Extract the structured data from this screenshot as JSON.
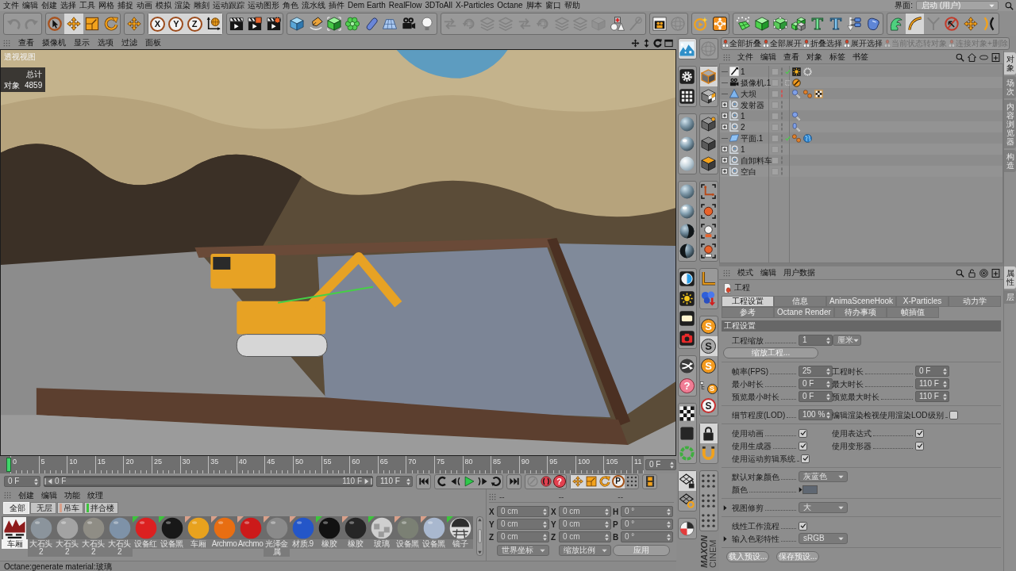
{
  "menu_bar": {
    "items": [
      "文件",
      "编辑",
      "创建",
      "选择",
      "工具",
      "网格",
      "捕捉",
      "动画",
      "模拟",
      "渲染",
      "雕刻",
      "运动跟踪",
      "运动图形",
      "角色",
      "流水线",
      "插件",
      "Dem Earth",
      "RealFlow",
      "3DToAll",
      "X-Particles",
      "Octane",
      "脚本",
      "窗口",
      "帮助"
    ],
    "layout_label": "界面:",
    "layout_value": "启动 (用户)"
  },
  "toolbar": {
    "groups": [
      {
        "tools": [
          {
            "kind": "undo",
            "selected": false,
            "disabled": true
          },
          {
            "kind": "redo",
            "selected": false,
            "disabled": true
          }
        ]
      },
      {
        "tools": [
          {
            "kind": "select",
            "selected": false,
            "disabled": false
          },
          {
            "kind": "move",
            "selected": true,
            "disabled": false
          },
          {
            "kind": "scale",
            "selected": false,
            "disabled": false
          },
          {
            "kind": "rotate",
            "selected": false,
            "disabled": false
          }
        ]
      },
      {
        "tools": [
          {
            "kind": "move",
            "selected": false,
            "disabled": false
          }
        ]
      },
      {
        "tools": [
          {
            "kind": "axis",
            "label": "X",
            "selected": true,
            "disabled": false
          },
          {
            "kind": "axis",
            "label": "Y",
            "selected": true,
            "disabled": false
          },
          {
            "kind": "axis",
            "label": "Z",
            "selected": true,
            "disabled": false
          },
          {
            "kind": "world",
            "selected": true,
            "disabled": false
          }
        ]
      },
      {
        "tools": [
          {
            "kind": "clapper",
            "selected": false,
            "disabled": false
          },
          {
            "kind": "clapper-tile",
            "selected": false,
            "disabled": false
          },
          {
            "kind": "clapper-gear",
            "selected": false,
            "disabled": false
          }
        ]
      },
      {
        "tools": [
          {
            "kind": "cube-blue",
            "selected": false,
            "disabled": false
          },
          {
            "kind": "pen",
            "selected": false,
            "disabled": false
          },
          {
            "kind": "cube-frame",
            "selected": false,
            "disabled": false
          },
          {
            "kind": "flower",
            "selected": false,
            "disabled": false
          },
          {
            "kind": "capsule",
            "selected": false,
            "disabled": false
          },
          {
            "kind": "floor",
            "selected": false,
            "disabled": false
          },
          {
            "kind": "camera",
            "selected": false,
            "disabled": false
          },
          {
            "kind": "bulb",
            "selected": false,
            "disabled": false
          }
        ]
      },
      {
        "tools": [
          {
            "kind": "faded-arrows",
            "selected": false,
            "disabled": true
          },
          {
            "kind": "faded-loop",
            "selected": false,
            "disabled": true
          },
          {
            "kind": "faded-stack",
            "selected": false,
            "disabled": true
          },
          {
            "kind": "faded-stack",
            "selected": false,
            "disabled": true
          },
          {
            "kind": "faded-arrows",
            "selected": false,
            "disabled": true
          },
          {
            "kind": "faded-loop",
            "selected": false,
            "disabled": true
          },
          {
            "kind": "faded-stack",
            "selected": false,
            "disabled": true
          },
          {
            "kind": "faded-stack",
            "selected": false,
            "disabled": true
          },
          {
            "kind": "faded-cube",
            "selected": false,
            "disabled": true
          },
          {
            "kind": "shapes",
            "selected": false,
            "disabled": false
          },
          {
            "kind": "faded-slash",
            "selected": false,
            "disabled": true
          }
        ]
      },
      {
        "tools": [
          {
            "kind": "clapper-camera",
            "selected": false,
            "disabled": false
          },
          {
            "kind": "faded-sphere",
            "selected": false,
            "disabled": true
          }
        ]
      },
      {
        "tools": [
          {
            "kind": "play-circle",
            "selected": false,
            "disabled": false
          },
          {
            "kind": "node-cluster",
            "selected": false,
            "disabled": false
          }
        ]
      },
      {
        "tools": [
          {
            "kind": "sparkle-grid",
            "selected": false,
            "disabled": false
          },
          {
            "kind": "cube-green",
            "selected": false,
            "disabled": false
          },
          {
            "kind": "node-cube",
            "selected": false,
            "disabled": false
          },
          {
            "kind": "stacked-cubes",
            "selected": false,
            "disabled": false
          },
          {
            "kind": "text-green",
            "label": "T",
            "selected": false,
            "disabled": false
          },
          {
            "kind": "text-blue",
            "label": "T",
            "selected": false,
            "disabled": false
          },
          {
            "kind": "branch",
            "selected": false,
            "disabled": false
          },
          {
            "kind": "blob",
            "selected": false,
            "disabled": false
          }
        ]
      },
      {
        "tools": [
          {
            "kind": "leaf",
            "selected": false,
            "disabled": false
          },
          {
            "kind": "curve",
            "selected": true,
            "disabled": false
          },
          {
            "kind": "faded-fork",
            "selected": false,
            "disabled": true
          },
          {
            "kind": "no-arrow",
            "selected": false,
            "disabled": false
          },
          {
            "kind": "move",
            "selected": false,
            "disabled": false
          },
          {
            "kind": "bracket",
            "selected": false,
            "disabled": false
          }
        ]
      }
    ]
  },
  "viewport": {
    "menu": [
      "查看",
      "摄像机",
      "显示",
      "选项",
      "过滤",
      "面板"
    ],
    "title": "透视视图",
    "stats": {
      "heading": "总计",
      "label": "对象",
      "value": "4859"
    }
  },
  "timeline": {
    "ticks": [
      "0",
      "5",
      "10",
      "15",
      "20",
      "25",
      "30",
      "35",
      "40",
      "45",
      "50",
      "55",
      "60",
      "65",
      "70",
      "75",
      "80",
      "85",
      "90",
      "95",
      "100",
      "105",
      "11"
    ],
    "playhead": {
      "level": 0
    },
    "current": "0 F"
  },
  "transport": {
    "start": "0 F",
    "range": {
      "start": "0 F",
      "end": "110 F",
      "level": 1
    },
    "end": "110 F",
    "groups": [
      {
        "tools": [
          {
            "kind": "skip-start",
            "selected": false,
            "disabled": false
          }
        ]
      },
      {
        "tools": [
          {
            "kind": "loop-back",
            "selected": false,
            "disabled": false
          },
          {
            "kind": "step-back",
            "selected": false,
            "disabled": false
          },
          {
            "kind": "play",
            "selected": false,
            "disabled": false
          },
          {
            "kind": "step-forward",
            "selected": false,
            "disabled": false
          },
          {
            "kind": "repeat",
            "selected": false,
            "disabled": false
          }
        ]
      },
      {
        "tools": [
          {
            "kind": "skip-end",
            "selected": false,
            "disabled": false
          }
        ]
      },
      {
        "tools": [
          {
            "kind": "faded-key",
            "selected": false,
            "disabled": true
          },
          {
            "kind": "record",
            "selected": false,
            "disabled": false
          },
          {
            "kind": "help",
            "label": "?",
            "selected": false,
            "disabled": false
          }
        ]
      },
      {
        "tools": [
          {
            "kind": "move",
            "selected": true,
            "disabled": false
          },
          {
            "kind": "scale",
            "selected": true,
            "disabled": false
          },
          {
            "kind": "rotate",
            "selected": true,
            "disabled": false
          },
          {
            "kind": "param",
            "label": "P",
            "selected": true,
            "disabled": false
          },
          {
            "kind": "dot-grid",
            "selected": false,
            "disabled": false
          }
        ]
      },
      {
        "tools": [
          {
            "kind": "film",
            "selected": false,
            "disabled": false
          }
        ]
      }
    ]
  },
  "materials": {
    "menu": [
      "创建",
      "编辑",
      "功能",
      "纹理"
    ],
    "layers": [
      {
        "label": "全部",
        "selected": true
      },
      {
        "label": "无层",
        "selected": false
      },
      {
        "label": "吊车",
        "selected": false,
        "color": "#d9a08a"
      },
      {
        "label": "拌合楼",
        "selected": false,
        "color": "#3cc43c"
      }
    ],
    "items": [
      {
        "kind": "thumbnail",
        "label": "车厢",
        "color": "#8e1c1c",
        "selected": true
      },
      {
        "kind": "sphere",
        "label": "大石头2",
        "color": "#8b949c",
        "selected": false
      },
      {
        "kind": "sphere",
        "label": "大石头2",
        "color": "#a3a3a3",
        "selected": false
      },
      {
        "kind": "sphere",
        "label": "大石头2",
        "color": "#8f8d85",
        "selected": false
      },
      {
        "kind": "sphere",
        "label": "大石头2",
        "color": "#7e92a8",
        "selected": false
      },
      {
        "kind": "sphere",
        "label": "设备红",
        "color": "#dc2020",
        "flag": {
          "color": "#3cc43c"
        },
        "selected": false
      },
      {
        "kind": "sphere",
        "label": "设备黑",
        "color": "#181818",
        "flag": {
          "color": "#3cc43c"
        },
        "selected": false
      },
      {
        "kind": "sphere",
        "label": "车厢",
        "color": "#e8a21e",
        "flag": {
          "color": "#d9a08a"
        },
        "selected": false
      },
      {
        "kind": "sphere",
        "label": "Archmo",
        "color": "#e86e12",
        "flag": {
          "color": "#d9a08a"
        },
        "selected": false
      },
      {
        "kind": "sphere",
        "label": "Archmo",
        "color": "#cc1a1a",
        "flag": {
          "color": "#d9a08a"
        },
        "selected": false
      },
      {
        "kind": "sphere",
        "label": "光泽金属",
        "color": "#8a8a8a",
        "flag": {
          "color": "#d9a08a"
        },
        "selected": false
      },
      {
        "kind": "sphere",
        "label": "材质.9",
        "color": "#2456c8",
        "flag": {
          "color": "#d9a08a"
        },
        "selected": false
      },
      {
        "kind": "sphere",
        "label": "橡胶",
        "color": "#121212",
        "flag": {
          "color": "#3cc43c"
        },
        "selected": false
      },
      {
        "kind": "sphere",
        "label": "橡胶",
        "color": "#262626",
        "flag": {
          "color": "#d9a08a"
        },
        "selected": false
      },
      {
        "kind": "glass",
        "label": "玻璃",
        "color": "#cfcfcf",
        "flag": {
          "color": "#3cc43c"
        },
        "selected": false
      },
      {
        "kind": "sphere",
        "label": "设备黑",
        "color": "#7b8074",
        "flag": {
          "color": "#d9a08a"
        },
        "selected": false
      },
      {
        "kind": "sphere",
        "label": "设备黑",
        "color": "#a9b8cf",
        "flag": {
          "color": "#d9a08a"
        },
        "selected": false
      },
      {
        "kind": "mirror",
        "label": "镜子",
        "color": "#dcdcdc",
        "flag": {
          "color": "#3cc43c"
        },
        "selected": false
      }
    ]
  },
  "coordinates": {
    "headers": [
      "--",
      "--",
      "--"
    ],
    "columns": [
      {
        "rows": [
          {
            "axis": "X",
            "value": "0 cm"
          },
          {
            "axis": "Y",
            "value": "0 cm"
          },
          {
            "axis": "Z",
            "value": "0 cm"
          }
        ]
      },
      {
        "rows": [
          {
            "axis": "X",
            "value": "0 cm"
          },
          {
            "axis": "Y",
            "value": "0 cm"
          },
          {
            "axis": "Z",
            "value": "0 cm"
          }
        ]
      },
      {
        "rows": [
          {
            "axis": "H",
            "value": "0 °"
          },
          {
            "axis": "P",
            "value": "0 °"
          },
          {
            "axis": "B",
            "value": "0 °"
          }
        ]
      }
    ],
    "dropdowns": [
      "世界坐标",
      "缩放比例"
    ],
    "apply": "应用"
  },
  "status_bar": "Octane:generate material:玻璃",
  "side_toolbar": {
    "columns": [
      {
        "groups": [
          {
            "tools": [
              {
                "kind": "landscape",
                "selected": true,
                "disabled": false
              }
            ]
          },
          {
            "tools": [
              {
                "kind": "gear-tile",
                "selected": false,
                "disabled": false
              },
              {
                "kind": "grid-tile",
                "selected": false,
                "disabled": false
              }
            ]
          },
          {
            "tools": [
              {
                "kind": "sphere",
                "selected": false,
                "disabled": false
              },
              {
                "kind": "sphere-gloss",
                "selected": false,
                "disabled": false
              },
              {
                "kind": "sphere-glass",
                "selected": false,
                "disabled": false
              }
            ]
          },
          {
            "tools": [
              {
                "kind": "sphere",
                "selected": false,
                "disabled": false
              },
              {
                "kind": "sphere-gloss",
                "selected": false,
                "disabled": false
              },
              {
                "kind": "sphere-dark",
                "selected": false,
                "disabled": false
              },
              {
                "kind": "sphere-dark-left",
                "selected": false,
                "disabled": false
              }
            ]
          },
          {
            "tools": [
              {
                "kind": "contrast",
                "selected": false,
                "disabled": false
              },
              {
                "kind": "sun-tile",
                "selected": false,
                "disabled": false
              },
              {
                "kind": "light-tile",
                "selected": false,
                "disabled": false
              },
              {
                "kind": "camera-tile",
                "selected": false,
                "disabled": false
              }
            ]
          },
          {
            "tools": [
              {
                "kind": "shuffle",
                "selected": false,
                "disabled": false
              },
              {
                "kind": "help-pink",
                "label": "?",
                "selected": false,
                "disabled": false
              }
            ]
          },
          {
            "tools": [
              {
                "kind": "chessboard",
                "selected": false,
                "disabled": false
              },
              {
                "kind": "square-tile",
                "selected": false,
                "disabled": false
              },
              {
                "kind": "ring",
                "selected": false,
                "disabled": false
              }
            ]
          },
          {
            "tools": [
              {
                "kind": "grid-lock",
                "selected": true,
                "disabled": false
              },
              {
                "kind": "grid-rotate",
                "selected": false,
                "disabled": false
              }
            ]
          },
          {
            "tools": [
              {
                "kind": "split-sphere",
                "selected": false,
                "disabled": false
              }
            ]
          }
        ]
      },
      {
        "groups": [
          {
            "tools": [
              {
                "kind": "faded-sphere",
                "selected": false,
                "disabled": true
              }
            ]
          },
          {
            "tools": [
              {
                "kind": "cube-edge",
                "selected": true,
                "disabled": false
              },
              {
                "kind": "tiled-cube",
                "selected": false,
                "disabled": false
              }
            ]
          },
          {
            "tools": [
              {
                "kind": "cube-dot",
                "selected": false,
                "disabled": false
              },
              {
                "kind": "cube-dark",
                "selected": false,
                "disabled": false
              },
              {
                "kind": "cube-top",
                "selected": false,
                "disabled": false
              }
            ]
          },
          {
            "tools": [
              {
                "kind": "corner-path",
                "selected": false,
                "disabled": false
              },
              {
                "kind": "target-dot",
                "selected": false,
                "disabled": false
              },
              {
                "kind": "target-node",
                "selected": false,
                "disabled": false
              },
              {
                "kind": "target-node-alt",
                "selected": false,
                "disabled": false
              }
            ]
          },
          {
            "tools": [
              {
                "kind": "axis-corner",
                "selected": false,
                "disabled": false
              },
              {
                "kind": "spheres-arrow",
                "selected": false,
                "disabled": false
              }
            ]
          },
          {
            "tools": [
              {
                "kind": "s-orange",
                "label": "S",
                "selected": false,
                "disabled": false
              },
              {
                "kind": "s-grey",
                "label": "S",
                "selected": true,
                "disabled": false
              },
              {
                "kind": "s-orange",
                "label": "S",
                "selected": false,
                "disabled": false
              },
              {
                "kind": "hier-s",
                "label": "S",
                "selected": false,
                "disabled": false
              },
              {
                "kind": "s-ring",
                "label": "S",
                "selected": false,
                "disabled": false
              }
            ]
          },
          {
            "tools": [
              {
                "kind": "lock",
                "selected": true,
                "disabled": false
              },
              {
                "kind": "magnet",
                "selected": false,
                "disabled": false
              }
            ]
          },
          {
            "tools": [
              {
                "kind": "dot-grid",
                "selected": false,
                "disabled": false
              },
              {
                "kind": "dot-grid",
                "selected": false,
                "disabled": false
              },
              {
                "kind": "dot-grid",
                "selected": false,
                "disabled": false
              }
            ]
          }
        ]
      }
    ],
    "logo": {
      "brand": "MAXON",
      "product": "CINEM"
    }
  },
  "object_manager": {
    "buttons": [
      {
        "label": "全部折叠",
        "disabled": false
      },
      {
        "label": "全部展开",
        "disabled": false
      },
      {
        "label": "折叠选择",
        "disabled": false
      },
      {
        "label": "展开选择",
        "disabled": false
      },
      {
        "label": "当前状态转对象",
        "disabled": true
      },
      {
        "label": "连接对象+删除",
        "disabled": true
      }
    ],
    "menu": [
      "文件",
      "编辑",
      "查看",
      "对象",
      "标签",
      "书签"
    ],
    "objects": [
      {
        "name": "1",
        "kind": "spline",
        "collapsed": false,
        "hidden": false,
        "checked": true,
        "inactive": false,
        "tags": [
          {
            "kind": "sun-tag"
          },
          {
            "kind": "gear-tag"
          }
        ]
      },
      {
        "name": "摄像机.1",
        "kind": "camera",
        "collapsed": false,
        "hidden": false,
        "checked": false,
        "inactive": true,
        "tags": [
          {
            "kind": "no-sign"
          }
        ]
      },
      {
        "name": "大坝",
        "kind": "cone",
        "collapsed": false,
        "hidden": true,
        "checked": false,
        "inactive": false,
        "tags": [
          {
            "kind": "sphere-chain"
          },
          {
            "kind": "beads"
          },
          {
            "kind": "chess-tag"
          }
        ]
      },
      {
        "name": "发射器",
        "kind": "null",
        "collapsed": true,
        "hidden": false,
        "checked": false,
        "inactive": false
      },
      {
        "name": "1",
        "kind": "null",
        "collapsed": true,
        "hidden": false,
        "checked": false,
        "inactive": false,
        "tags": [
          {
            "kind": "sphere-chain"
          }
        ]
      },
      {
        "name": "2",
        "kind": "null",
        "collapsed": true,
        "hidden": false,
        "checked": false,
        "inactive": false,
        "tags": [
          {
            "kind": "capsule-chain"
          }
        ]
      },
      {
        "name": "平面.1",
        "kind": "plane",
        "collapsed": false,
        "hidden": false,
        "checked": true,
        "inactive": false,
        "tags": [
          {
            "kind": "beads"
          },
          {
            "kind": "globe"
          }
        ]
      },
      {
        "name": "1",
        "kind": "null",
        "collapsed": true,
        "hidden": false,
        "checked": false,
        "inactive": false
      },
      {
        "name": "自卸料车",
        "kind": "null",
        "collapsed": true,
        "hidden": false,
        "checked": false,
        "inactive": false
      },
      {
        "name": "空白",
        "kind": "null",
        "collapsed": true,
        "hidden": false,
        "checked": false,
        "inactive": false
      }
    ]
  },
  "side_tabs": {
    "upper": [
      {
        "label": "对象",
        "selected": true
      },
      {
        "label": "场次",
        "selected": false
      },
      {
        "label": "内容浏览器",
        "selected": false
      },
      {
        "label": "构造",
        "selected": false
      }
    ],
    "lower": [
      {
        "label": "属性",
        "selected": true
      },
      {
        "label": "层",
        "selected": false
      }
    ]
  },
  "attributes": {
    "menu": [
      "模式",
      "编辑",
      "用户数据"
    ],
    "title": "工程",
    "tabs": [
      [
        {
          "label": "工程设置",
          "selected": true
        },
        {
          "label": "信息",
          "selected": false
        },
        {
          "label": "AnimaSceneHook",
          "selected": false
        },
        {
          "label": "X-Particles",
          "selected": false
        },
        {
          "label": "动力学",
          "selected": false
        }
      ],
      [
        {
          "label": "参考",
          "selected": false
        },
        {
          "label": "Octane Render",
          "selected": false
        },
        {
          "label": "待办事项",
          "selected": false
        },
        {
          "label": "帧插值",
          "selected": false
        }
      ]
    ],
    "section": "工程设置",
    "groups": [
      {
        "rows": [
          {
            "cells": [
              {
                "kind": "spin",
                "label": "工程缩放",
                "value": "1",
                "unit": "厘米"
              }
            ]
          },
          {
            "cells": [
              {
                "kind": "button",
                "label": "缩放工程..."
              }
            ]
          }
        ]
      },
      {
        "rows": [
          {
            "cells": [
              {
                "kind": "spin",
                "label": "帧率(FPS)",
                "value": "25"
              },
              {
                "kind": "spin",
                "label": "工程时长",
                "value": "0 F"
              }
            ]
          },
          {
            "cells": [
              {
                "kind": "spin",
                "label": "最小时长",
                "value": "0 F"
              },
              {
                "kind": "spin",
                "label": "最大时长",
                "value": "110 F"
              }
            ]
          },
          {
            "cells": [
              {
                "kind": "spin",
                "label": "预览最小时长",
                "value": "0 F"
              },
              {
                "kind": "spin",
                "label": "预览最大时长",
                "value": "110 F"
              }
            ]
          }
        ]
      },
      {
        "rows": [
          {
            "cells": [
              {
                "kind": "spin",
                "label": "细节程度(LOD)",
                "value": "100 %"
              },
              {
                "kind": "check",
                "label": "编辑渲染检视使用渲染LOD级别",
                "checked": false
              }
            ]
          }
        ]
      },
      {
        "rows": [
          {
            "cells": [
              {
                "kind": "check",
                "label": "使用动画",
                "checked": true
              },
              {
                "kind": "check",
                "label": "使用表达式",
                "checked": true
              }
            ]
          },
          {
            "cells": [
              {
                "kind": "check",
                "label": "使用生成器",
                "checked": true
              },
              {
                "kind": "check",
                "label": "使用变形器",
                "checked": true
              }
            ]
          },
          {
            "cells": [
              {
                "kind": "check",
                "label": "使用运动剪辑系统",
                "checked": true
              }
            ]
          }
        ]
      },
      {
        "rows": [
          {
            "cells": [
              {
                "kind": "dropdown",
                "label": "默认对象颜色",
                "value": "灰蓝色",
                "foldable": false
              }
            ]
          },
          {
            "cells": [
              {
                "kind": "color",
                "label": "颜色",
                "color": "#5f6772",
                "foldable": true
              }
            ]
          }
        ]
      },
      {
        "rows": [
          {
            "cells": [
              {
                "kind": "dropdown",
                "label": "视图修剪",
                "value": "大",
                "foldable": true
              }
            ]
          }
        ]
      },
      {
        "rows": [
          {
            "cells": [
              {
                "kind": "check",
                "label": "线性工作流程",
                "checked": true
              }
            ]
          },
          {
            "cells": [
              {
                "kind": "dropdown",
                "label": "输入色彩特性",
                "value": "sRGB",
                "foldable": true
              }
            ]
          }
        ]
      }
    ],
    "buttons": [
      "载入预设...",
      "保存预设..."
    ]
  }
}
